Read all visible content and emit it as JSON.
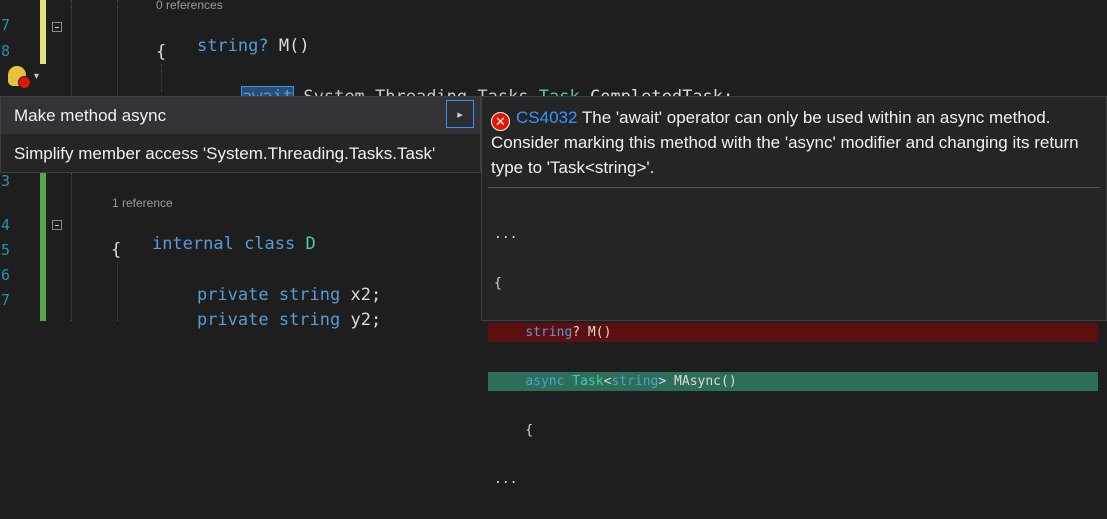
{
  "editor": {
    "line_numbers": [
      "7",
      "8",
      "3",
      "4",
      "5",
      "6",
      "7"
    ],
    "line1_refs": "0 references",
    "line1_keyword": "string",
    "line1_nullable": "?",
    "line1_name": " M()",
    "line2_brace": "{",
    "line3_await": "await",
    "line3_ns": " System.Threading.Tasks.",
    "line3_type": "Task",
    "line3_member": ".CompletedTask;",
    "class_refs": "1 reference",
    "class_kw": "internal class",
    "class_name": " D",
    "class_brace": "{",
    "field1_kw": "private string",
    "field1_name": " x2;",
    "field2_kw": "private string",
    "field2_name": " y2;"
  },
  "lightbulb": {
    "icon": "lightbulb-error-icon",
    "caret": "▾"
  },
  "quick_actions": {
    "items": [
      {
        "label": "Make method async"
      },
      {
        "label": "Simplify member access 'System.Threading.Tasks.Task'"
      }
    ],
    "submenu_arrow": "▸"
  },
  "diagnostic": {
    "code": "CS4032",
    "message": " The 'await' operator can only be used within an async method. Consider marking this method with the 'async' modifier and changing its return type to 'Task<string>'.",
    "icon_glyph": "✕"
  },
  "preview": {
    "ellipsis_top": "...",
    "brace_open": "{",
    "removed_kw": "string",
    "removed_rest": "? M()",
    "added_kw": "async",
    "added_type": "Task",
    "added_lt": "<",
    "added_kw2": "string",
    "added_rest": "> MAsync()",
    "brace_line": "    {",
    "ellipsis_bottom": "..."
  },
  "colors": {
    "background": "#1e1e1e",
    "error": "#e51400",
    "keyword": "#569cd6",
    "type": "#4ec9b0",
    "removed_bg": "#5c0f0f",
    "added_bg": "#2c6e58"
  }
}
